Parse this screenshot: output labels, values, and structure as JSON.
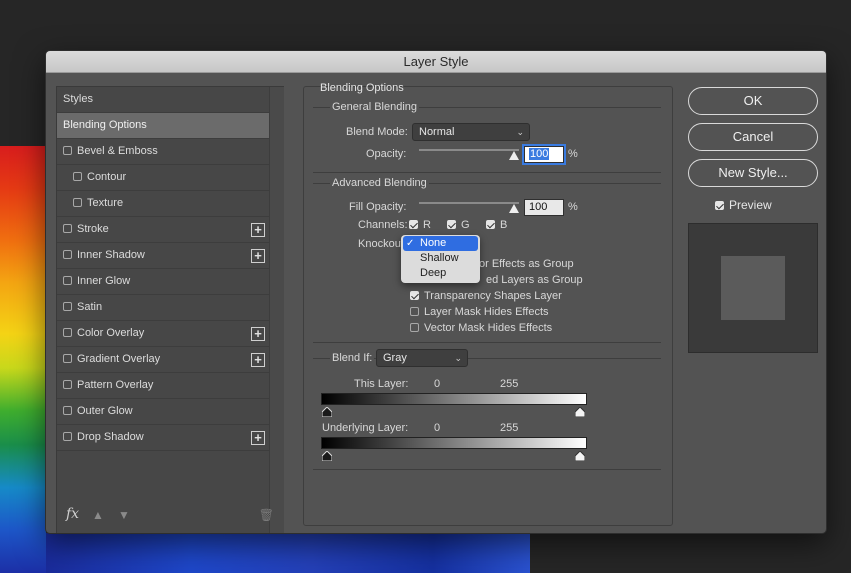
{
  "window": {
    "title": "Layer Style"
  },
  "styles_list": {
    "items": [
      {
        "label": "Styles",
        "checkbox": false,
        "checked": false,
        "plus": false,
        "selected": false,
        "sub": false
      },
      {
        "label": "Blending Options",
        "checkbox": false,
        "checked": false,
        "plus": false,
        "selected": true,
        "sub": false
      },
      {
        "label": "Bevel & Emboss",
        "checkbox": true,
        "checked": false,
        "plus": false,
        "selected": false,
        "sub": false
      },
      {
        "label": "Contour",
        "checkbox": true,
        "checked": false,
        "plus": false,
        "selected": false,
        "sub": true
      },
      {
        "label": "Texture",
        "checkbox": true,
        "checked": false,
        "plus": false,
        "selected": false,
        "sub": true
      },
      {
        "label": "Stroke",
        "checkbox": true,
        "checked": false,
        "plus": true,
        "selected": false,
        "sub": false
      },
      {
        "label": "Inner Shadow",
        "checkbox": true,
        "checked": false,
        "plus": true,
        "selected": false,
        "sub": false
      },
      {
        "label": "Inner Glow",
        "checkbox": true,
        "checked": false,
        "plus": false,
        "selected": false,
        "sub": false
      },
      {
        "label": "Satin",
        "checkbox": true,
        "checked": false,
        "plus": false,
        "selected": false,
        "sub": false
      },
      {
        "label": "Color Overlay",
        "checkbox": true,
        "checked": false,
        "plus": true,
        "selected": false,
        "sub": false
      },
      {
        "label": "Gradient Overlay",
        "checkbox": true,
        "checked": false,
        "plus": true,
        "selected": false,
        "sub": false
      },
      {
        "label": "Pattern Overlay",
        "checkbox": true,
        "checked": false,
        "plus": false,
        "selected": false,
        "sub": false
      },
      {
        "label": "Outer Glow",
        "checkbox": true,
        "checked": false,
        "plus": false,
        "selected": false,
        "sub": false
      },
      {
        "label": "Drop Shadow",
        "checkbox": true,
        "checked": false,
        "plus": true,
        "selected": false,
        "sub": false
      }
    ],
    "footer": {
      "fx_label": "fx"
    }
  },
  "blending": {
    "section_title": "Blending Options",
    "general": {
      "title": "General Blending",
      "blend_mode_label": "Blend Mode:",
      "blend_mode_value": "Normal",
      "opacity_label": "Opacity:",
      "opacity_value": "100",
      "opacity_unit": "%",
      "opacity_level": 1.0
    },
    "advanced": {
      "title": "Advanced Blending",
      "fill_opacity_label": "Fill Opacity:",
      "fill_opacity_value": "100",
      "fill_opacity_unit": "%",
      "channels_label": "Channels:",
      "channels": [
        {
          "label": "R",
          "checked": true
        },
        {
          "label": "G",
          "checked": true
        },
        {
          "label": "B",
          "checked": true
        }
      ],
      "knockout_label": "Knockout:",
      "knockout_options": [
        "None",
        "Shallow",
        "Deep"
      ],
      "knockout_selected": "None",
      "options": [
        {
          "label": "Blend Interior Effects as Group",
          "visible_text": "or Effects as Group",
          "checked": false
        },
        {
          "label": "Blend Clipped Layers as Group",
          "visible_text": "ed Layers as Group",
          "checked": false
        },
        {
          "label": "Transparency Shapes Layer",
          "visible_text": "Transparency Shapes Layer",
          "checked": true
        },
        {
          "label": "Layer Mask Hides Effects",
          "visible_text": "Layer Mask Hides Effects",
          "checked": false
        },
        {
          "label": "Vector Mask Hides Effects",
          "visible_text": "Vector Mask Hides Effects",
          "checked": false
        }
      ]
    },
    "blend_if": {
      "label": "Blend If:",
      "value": "Gray",
      "this_layer_label": "This Layer:",
      "this_layer_min": "0",
      "this_layer_max": "255",
      "underlying_label": "Underlying Layer:",
      "underlying_min": "0",
      "underlying_max": "255"
    }
  },
  "actions": {
    "ok_label": "OK",
    "cancel_label": "Cancel",
    "new_style_label": "New Style...",
    "preview_label": "Preview",
    "preview_checked": true
  },
  "colors": {
    "accent": "#2f6de1",
    "dialog_bg": "#535353"
  }
}
